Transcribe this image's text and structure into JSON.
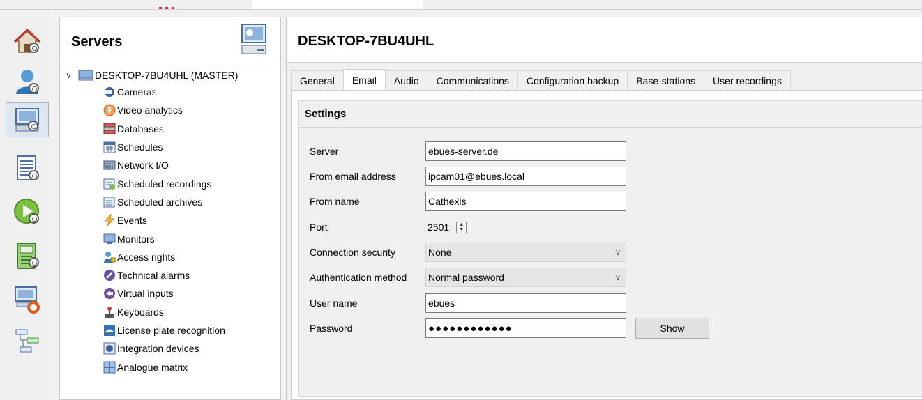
{
  "servers_panel": {
    "title": "Servers",
    "tree": {
      "root_label": "DESKTOP-7BU4UHL (MASTER)",
      "items": [
        {
          "label": "Cameras",
          "icon": "camera-icon"
        },
        {
          "label": "Video analytics",
          "icon": "analytics-icon"
        },
        {
          "label": "Databases",
          "icon": "database-icon"
        },
        {
          "label": "Schedules",
          "icon": "calendar-icon"
        },
        {
          "label": "Network I/O",
          "icon": "network-io-icon"
        },
        {
          "label": "Scheduled recordings",
          "icon": "scheduled-recording-icon"
        },
        {
          "label": "Scheduled archives",
          "icon": "scheduled-archive-icon"
        },
        {
          "label": "Events",
          "icon": "lightning-icon"
        },
        {
          "label": "Monitors",
          "icon": "monitor-icon"
        },
        {
          "label": "Access rights",
          "icon": "user-lock-icon"
        },
        {
          "label": "Technical alarms",
          "icon": "wrench-icon"
        },
        {
          "label": "Virtual inputs",
          "icon": "virtual-input-icon"
        },
        {
          "label": "Keyboards",
          "icon": "joystick-icon"
        },
        {
          "label": "License plate recognition",
          "icon": "license-plate-icon"
        },
        {
          "label": "Integration devices",
          "icon": "integration-icon"
        },
        {
          "label": "Analogue matrix",
          "icon": "matrix-icon"
        }
      ]
    }
  },
  "main": {
    "title": "DESKTOP-7BU4UHL",
    "tabs": [
      "General",
      "Email",
      "Audio",
      "Communications",
      "Configuration backup",
      "Base-stations",
      "User recordings"
    ],
    "active_tab": "Email",
    "settings": {
      "heading": "Settings",
      "server_label": "Server",
      "server_value": "ebues-server.de",
      "from_email_label": "From email address",
      "from_email_value": "ipcam01@ebues.local",
      "from_name_label": "From name",
      "from_name_value": "Cathexis",
      "port_label": "Port",
      "port_value": "2501",
      "connection_security_label": "Connection security",
      "connection_security_value": "None",
      "auth_method_label": "Authentication method",
      "auth_method_value": "Normal password",
      "user_name_label": "User name",
      "user_name_value": "ebues",
      "password_label": "Password",
      "password_value": "●●●●●●●●●●●●",
      "show_button": "Show"
    }
  },
  "nav_icons": [
    "home-settings-icon",
    "user-settings-icon",
    "server-settings-icon",
    "list-settings-icon",
    "play-settings-icon",
    "device-settings-icon",
    "server-lifebuoy-icon",
    "network-diagram-icon"
  ],
  "colors": {
    "active_nav_bg": "#dfe6ee",
    "panel_bg": "#f0f0f0"
  }
}
